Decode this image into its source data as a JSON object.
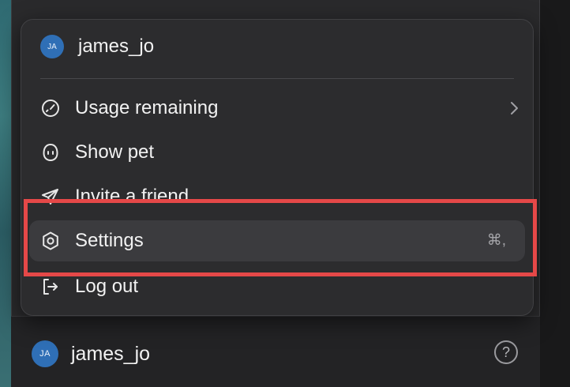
{
  "popup": {
    "user": {
      "avatar_initials": "JA",
      "username": "james_jo"
    },
    "items": [
      {
        "label": "Usage remaining",
        "icon": "gauge-icon",
        "trailing": "chevron-right"
      },
      {
        "label": "Show pet",
        "icon": "pet-icon",
        "trailing": ""
      },
      {
        "label": "Invite a friend",
        "icon": "paper-plane-icon",
        "trailing": ""
      },
      {
        "label": "Settings",
        "icon": "gear-icon",
        "shortcut": "⌘,",
        "active": true
      },
      {
        "label": "Log out",
        "icon": "logout-icon",
        "trailing": ""
      }
    ]
  },
  "footer": {
    "avatar_initials": "JA",
    "username": "james_jo",
    "help_icon": "help-icon",
    "help_glyph": "?"
  },
  "colors": {
    "highlight_border": "#e54848",
    "avatar_bg": "#2f6fb6",
    "menu_bg": "#2c2c2e",
    "active_item_bg": "#3b3b3e"
  }
}
